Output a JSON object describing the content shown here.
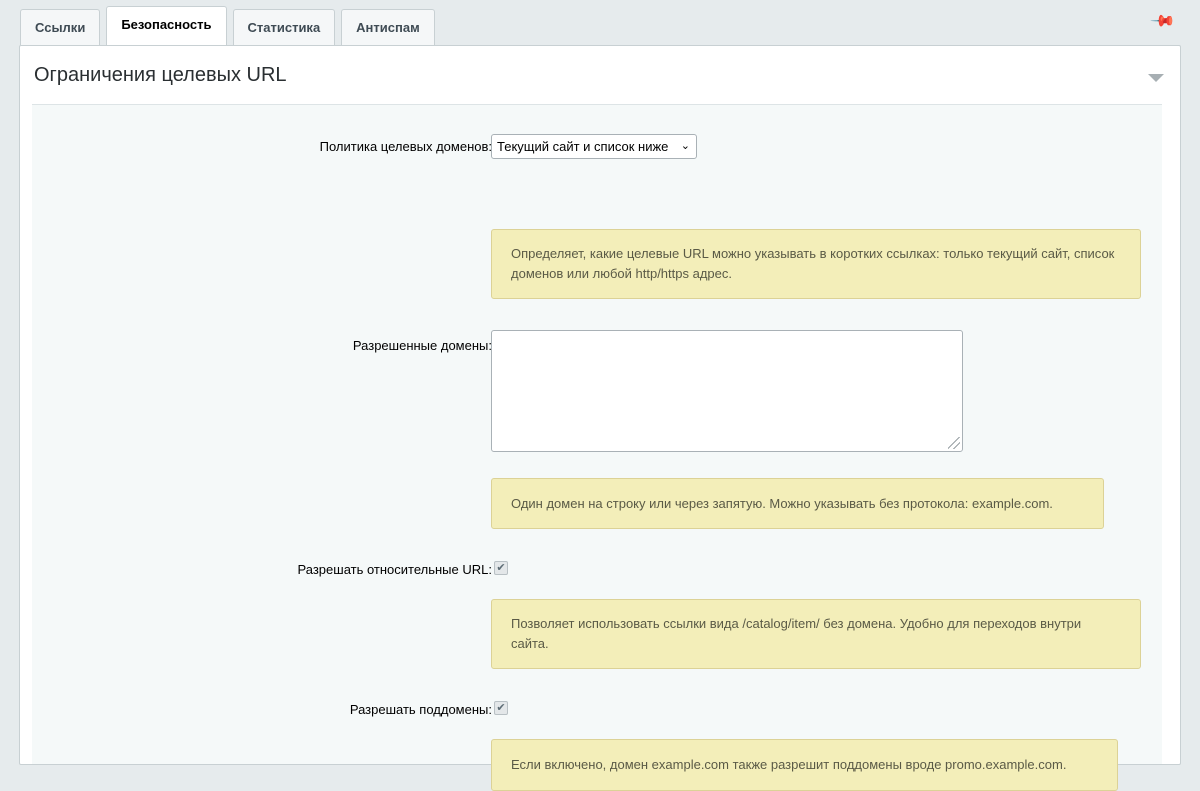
{
  "tabs": [
    {
      "label": "Ссылки",
      "active": false
    },
    {
      "label": "Безопасность",
      "active": true
    },
    {
      "label": "Статистика",
      "active": false
    },
    {
      "label": "Антиспам",
      "active": false
    }
  ],
  "panel": {
    "title": "Ограничения целевых URL"
  },
  "form": {
    "domain_policy": {
      "label": "Политика целевых доменов:",
      "selected": "Текущий сайт и список ниже",
      "hint": "Определяет, какие целевые URL можно указывать в коротких ссылках: только текущий сайт, список доменов или любой http/https адрес."
    },
    "allowed_domains": {
      "label": "Разрешенные домены:",
      "value": "",
      "hint": "Один домен на строку или через запятую. Можно указывать без протокола: example.com."
    },
    "allow_relative": {
      "label": "Разрешать относительные URL:",
      "checked": true,
      "hint": "Позволяет использовать ссылки вида /catalog/item/ без домена. Удобно для переходов внутри сайта."
    },
    "allow_subdomains": {
      "label": "Разрешать поддомены:",
      "checked": true,
      "hint": "Если включено, домен example.com также разрешит поддомены вроде promo.example.com."
    }
  },
  "icons": {
    "pin": "pin-icon",
    "collapse": "collapse-arrow-icon",
    "check": "check-icon"
  }
}
